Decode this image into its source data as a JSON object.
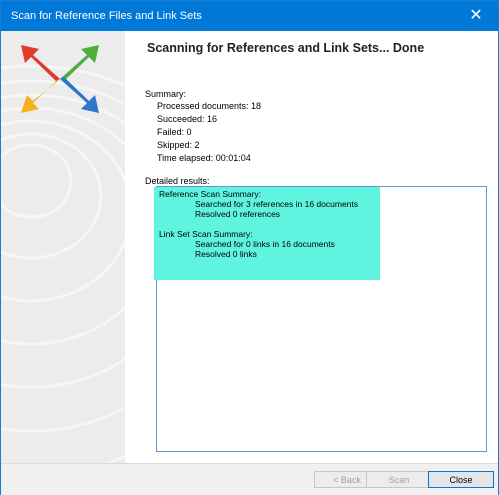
{
  "window": {
    "title": "Scan for Reference Files and Link Sets",
    "close_glyph": "✕"
  },
  "heading": "Scanning for References and Link Sets... Done",
  "summary": {
    "label": "Summary:",
    "lines": [
      "Processed documents: 18",
      "Succeeded: 16",
      "Failed: 0",
      "Skipped: 2",
      "Time elapsed: 00:01:04"
    ]
  },
  "details": {
    "label": "Detailed results:",
    "lines": [
      "Reference Scan Summary:",
      "Searched for 3 references in 16 documents",
      "Resolved 0 references",
      "Link Set Scan Summary:",
      "Searched for 0 links in 16 documents",
      "Resolved 0 links"
    ]
  },
  "buttons": {
    "back": "< Back",
    "scan": "Scan",
    "close": "Close"
  },
  "colors": {
    "titlebar": "#0078d7",
    "highlight": "#5ff4e0",
    "results_border": "#5a9bd5"
  },
  "icons": {
    "logo": "four-arrows-logo",
    "close": "close-icon"
  }
}
